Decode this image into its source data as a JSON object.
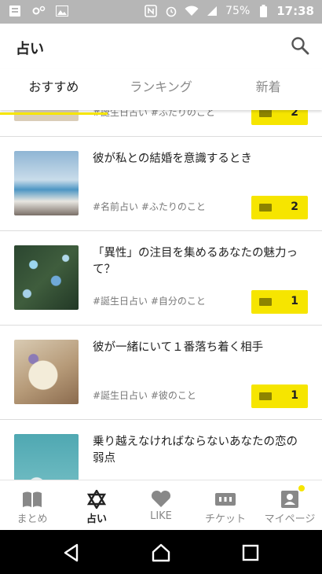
{
  "status_bar": {
    "battery": "75%",
    "time": "17:38"
  },
  "header": {
    "title": "占い",
    "search_icon": "search-icon"
  },
  "tabs": [
    {
      "label": "おすすめ",
      "active": true
    },
    {
      "label": "ランキング",
      "active": false
    },
    {
      "label": "新着",
      "active": false
    }
  ],
  "items": [
    {
      "title": "",
      "tags": "#誕生日占い #ふたりのこと",
      "count": "2",
      "thumb": "partial"
    },
    {
      "title": "彼が私との結婚を意識するとき",
      "tags": "#名前占い #ふたりのこと",
      "count": "2",
      "thumb": "ocean"
    },
    {
      "title": "「異性」の注目を集めるあなたの魅力って？",
      "tags": "#誕生日占い #自分のこと",
      "count": "1",
      "thumb": "flowers"
    },
    {
      "title": "彼が一緒にいて１番落ち着く相手",
      "tags": "#誕生日占い #彼のこと",
      "count": "1",
      "thumb": "soap"
    },
    {
      "title": "乗り越えなければならないあなたの恋の弱点",
      "tags": "",
      "count": "",
      "thumb": "teal"
    }
  ],
  "bottom_nav": [
    {
      "label": "まとめ",
      "icon": "book-icon",
      "active": false
    },
    {
      "label": "占い",
      "icon": "star-of-david-icon",
      "active": true
    },
    {
      "label": "LIKE",
      "icon": "heart-icon",
      "active": false
    },
    {
      "label": "チケット",
      "icon": "ticket-icon",
      "active": false
    },
    {
      "label": "マイページ",
      "icon": "profile-icon",
      "active": false
    }
  ],
  "colors": {
    "accent": "#f6e500",
    "status_bar": "#b6b6b6"
  }
}
